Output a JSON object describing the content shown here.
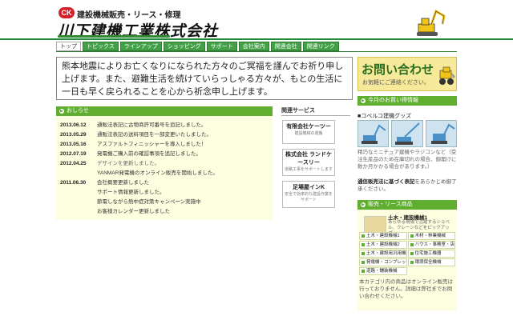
{
  "header": {
    "logo_mark": "CK",
    "tagline": "建設機械販売・リース・修理",
    "company": "川下建機工業株式会社"
  },
  "nav": {
    "items": [
      "トップ",
      "トピックス",
      "ラインアップ",
      "ショッピング",
      "サポート",
      "会社案内",
      "関連会社",
      "関連リンク"
    ],
    "active_index": 0
  },
  "condolence": {
    "text": "熊本地震によりお亡くなりになられた方々のご冥福を謹んでお祈り申し上げます。また、避難生活を続けていらっしゃる方々が、もとの生活に一日も早く戻られることを心から祈念申し上げます。"
  },
  "notices": {
    "header": "おしらせ",
    "items": [
      {
        "date": "2013.06.12",
        "text": "通販法表記に古物商許可番号を追記しました。",
        "dim": false
      },
      {
        "date": "2013.05.29",
        "text": "通販法表記の送料項目を一部変更いたしました。",
        "dim": false
      },
      {
        "date": "2013.05.16",
        "text": "アスファルトフィニッシャーを導入しました！",
        "dim": false
      },
      {
        "date": "2012.07.19",
        "text": "発電機ご購入前の確認事項を追記しました。",
        "dim": false
      },
      {
        "date": "2012.04.25",
        "text": "デザインを更新しました。",
        "dim": true
      },
      {
        "date": "",
        "text": "YANMAR発電機のオンライン販売を開始しました。",
        "dim": false
      },
      {
        "date": "2011.06.30",
        "text": "会社概要更新しました",
        "dim": false
      },
      {
        "date": "",
        "text": "サポート情報更新しました。",
        "dim": false
      },
      {
        "date": "",
        "text": "節電しながら熱中症対策キャンペーン実施中",
        "dim": false
      },
      {
        "date": "",
        "text": "お客様カレンダー更新しました",
        "dim": false
      }
    ]
  },
  "related": {
    "title": "関連サービス",
    "services": [
      {
        "name": "有限会社ケーツー",
        "sub": "建設機械の運搬"
      },
      {
        "name": "株式会社 ランドケースリー",
        "sub": "道路工事をサポートします"
      },
      {
        "name": "足場屋インK",
        "sub": "安全で効率的な建設作業をサポート"
      }
    ]
  },
  "contact": {
    "title": "お問い合わせ",
    "sub": "お気軽にご連絡ください。"
  },
  "monthly": {
    "header": "今月のお買い得情報",
    "goods_title": "■コベルコ建機グッズ",
    "goods_text": "精巧なミニチュア建機やラジコンなど（受注生産品のため在庫切れの場合、御届けに数か月かかる場合があります。）",
    "mail_bold": "通信販売法に基づく表記",
    "mail_rest": "をあらかじめ御了承ください。"
  },
  "products": {
    "header": "販売・リース商品",
    "feature_name": "土木・建設機械1",
    "feature_sub": "あらゆる現場で活躍するショベル、クレーンなどをピックアップ",
    "categories": [
      "土木・建設機械1",
      "木材・林業機械",
      "土木・建設機械2",
      "ハウス・事務室・店舗",
      "土木・建設用汎用機械",
      "住宅施工機器",
      "発電機・コンプレッサー",
      "環境保全機械",
      "道路・舗装機械"
    ],
    "note": "本カテゴリ内の商品はオンライン販売は行っておりません。詳細は弊社までお問い合わせください。"
  },
  "colors": {
    "accent_green": "#5fae2f",
    "rule_green": "#1e8a34",
    "panel_cream": "#fdfde0",
    "contact_yellow": "#f6e99a",
    "logo_red": "#d4202a"
  }
}
